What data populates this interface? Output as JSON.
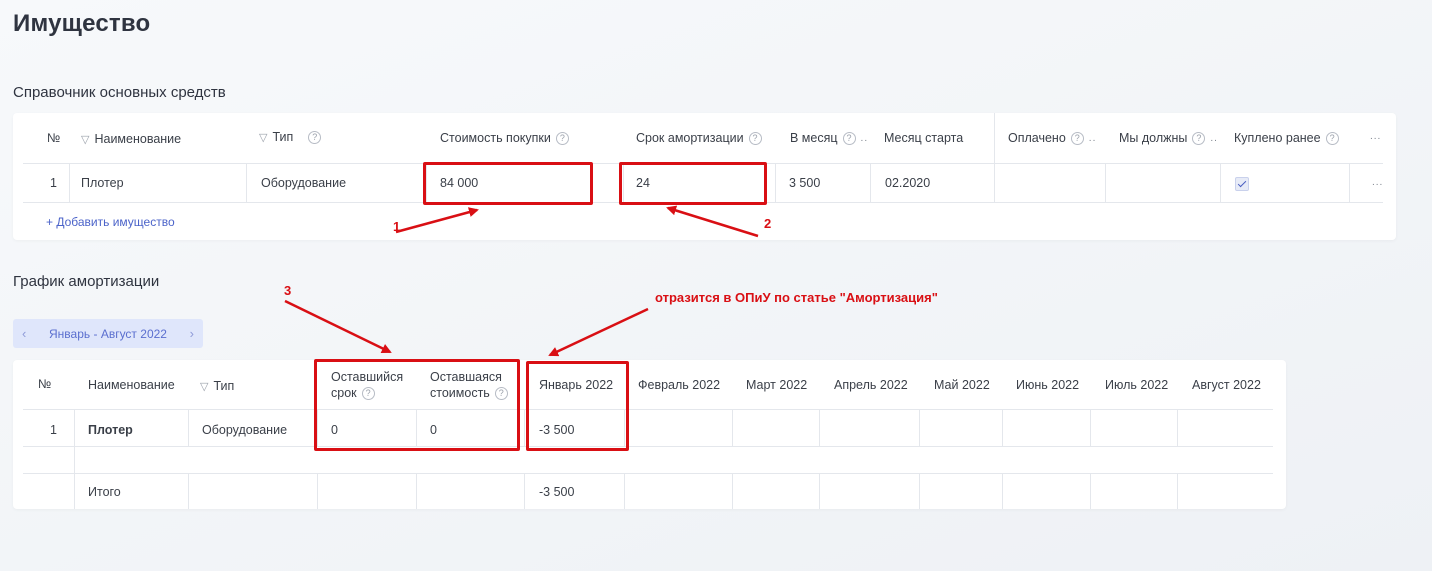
{
  "page": {
    "title": "Имущество"
  },
  "assets": {
    "section_title": "Справочник основных средств",
    "columns": {
      "num": "№",
      "name": "Наименование",
      "type": "Тип",
      "purchase_cost": "Стоимость покупки",
      "amort_term": "Срок амортизации",
      "per_month": "В месяц",
      "start_month": "Месяц старта",
      "paid": "Оплачено",
      "we_owe": "Мы должны",
      "bought_earlier": "Куплено ранее",
      "more": "..."
    },
    "rows": [
      {
        "num": "1",
        "name": "Плотер",
        "type": "Оборудование",
        "purchase_cost": "84 000",
        "amort_term": "24",
        "per_month": "3 500",
        "start_month": "02.2020",
        "row_menu": "..."
      }
    ],
    "add_link": "+ Добавить имущество"
  },
  "schedule": {
    "section_title": "График амортизации",
    "period": {
      "label": "Январь - Август 2022",
      "prev": "‹",
      "next": "›"
    },
    "columns": {
      "num": "№",
      "name": "Наименование",
      "type": "Тип",
      "remaining_term_1": "Оставшийся",
      "remaining_term_2": "срок",
      "remaining_cost_1": "Оставшаяся",
      "remaining_cost_2": "стоимость",
      "months": [
        "Январь 2022",
        "Февраль 2022",
        "Март 2022",
        "Апрель 2022",
        "Май 2022",
        "Июнь 2022",
        "Июль 2022",
        "Август 2022"
      ]
    },
    "rows": [
      {
        "num": "1",
        "name": "Плотер",
        "type": "Оборудование",
        "remaining_term": "0",
        "remaining_cost": "0",
        "jan": "-3 500"
      }
    ],
    "total": {
      "label": "Итого",
      "jan": "-3 500"
    }
  },
  "annotations": {
    "label_1": "1",
    "label_2": "2",
    "label_3": "3",
    "note": "отразится в ОПиУ по статье \"Амортизация\"",
    "color": "#d90f14"
  },
  "icons": {
    "help": "?",
    "filter": "▽"
  }
}
